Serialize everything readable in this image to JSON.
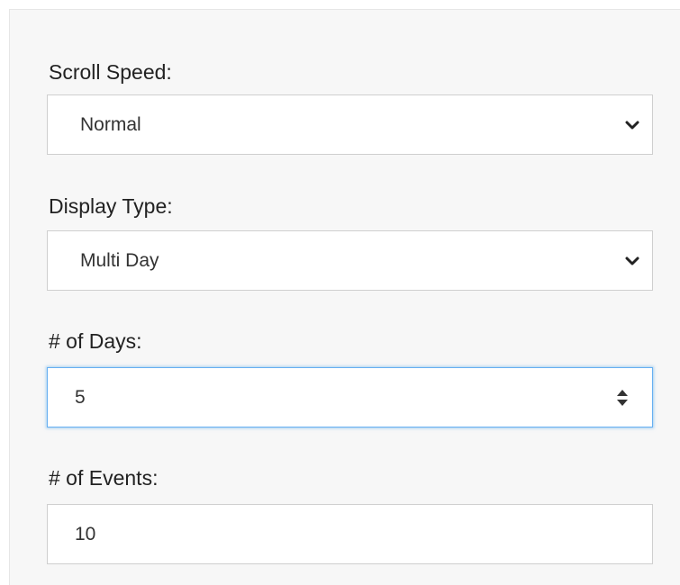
{
  "settings": {
    "scroll_speed": {
      "label": "Scroll Speed:",
      "selected": "Normal",
      "icon": "chevron-down-icon"
    },
    "display_type": {
      "label": "Display Type:",
      "selected": "Multi Day",
      "icon": "chevron-down-icon"
    },
    "num_days": {
      "label": "# of Days:",
      "value": "5",
      "icon": "spinner-arrows-icon"
    },
    "num_events": {
      "label": "# of Events:",
      "value": "10"
    }
  },
  "colors": {
    "panel_background": "#f7f7f7",
    "focus_border": "#66aff2",
    "text": "#222222"
  }
}
